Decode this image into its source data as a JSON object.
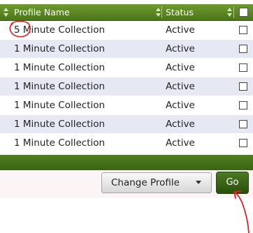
{
  "table": {
    "columns": {
      "name": "Profile Name",
      "status": "Status"
    },
    "rows": [
      {
        "name": "5 Minute Collection",
        "status": "Active"
      },
      {
        "name": "1 Minute Collection",
        "status": "Active"
      },
      {
        "name": "1 Minute Collection",
        "status": "Active"
      },
      {
        "name": "1 Minute Collection",
        "status": "Active"
      },
      {
        "name": "1 Minute Collection",
        "status": "Active"
      },
      {
        "name": "1 Minute Collection",
        "status": "Active"
      },
      {
        "name": "1 Minute Collection",
        "status": "Active"
      }
    ]
  },
  "actions": {
    "profile_select_value": "Change Profile",
    "go_label": "Go"
  },
  "icons": {
    "sort": "sort-icon",
    "dropdown": "chevron-down-icon"
  },
  "colors": {
    "header_green": "#5a8625",
    "row_alt": "#e6e9f4",
    "annotation_red": "#e02020"
  }
}
